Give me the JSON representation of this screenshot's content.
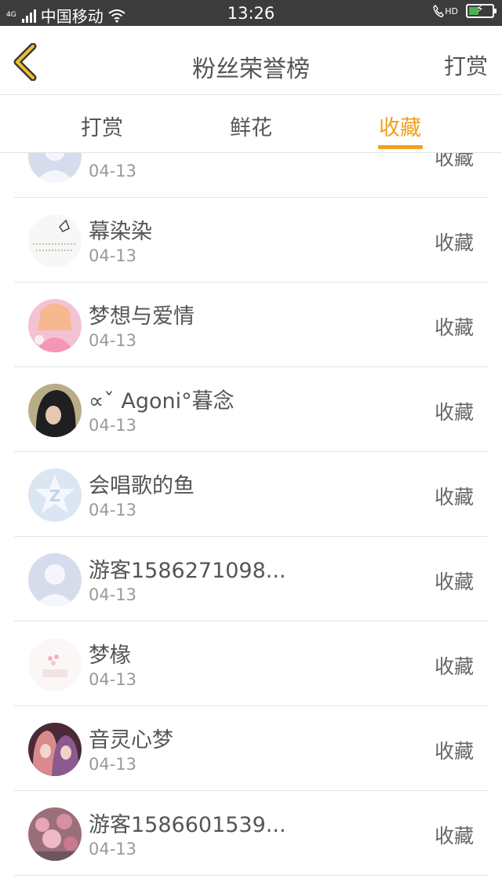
{
  "status_bar": {
    "network": "4G",
    "carrier": "中国移动",
    "time": "13:26",
    "hd_label": "HD",
    "battery_color": "#4caf50"
  },
  "header": {
    "back_icon": "chevron-left-icon",
    "title": "粉丝荣誉榜",
    "action_label": "打赏"
  },
  "tabs": [
    {
      "label": "打赏",
      "active": false
    },
    {
      "label": "鲜花",
      "active": false
    },
    {
      "label": "收藏",
      "active": true
    }
  ],
  "accent_color": "#f0a020",
  "fans": [
    {
      "name": "",
      "date": "04-13",
      "action": "收藏"
    },
    {
      "name": "幕染染",
      "date": "04-13",
      "action": "收藏"
    },
    {
      "name": "梦想与爱情",
      "date": "04-13",
      "action": "收藏"
    },
    {
      "name": "∝ˇ Agoni°暮念",
      "date": "04-13",
      "action": "收藏"
    },
    {
      "name": "会唱歌的鱼",
      "date": "04-13",
      "action": "收藏"
    },
    {
      "name": "游客1586271098...",
      "date": "04-13",
      "action": "收藏"
    },
    {
      "name": "梦椽",
      "date": "04-13",
      "action": "收藏"
    },
    {
      "name": "音灵心梦",
      "date": "04-13",
      "action": "收藏"
    },
    {
      "name": "游客1586601539...",
      "date": "04-13",
      "action": "收藏"
    }
  ]
}
